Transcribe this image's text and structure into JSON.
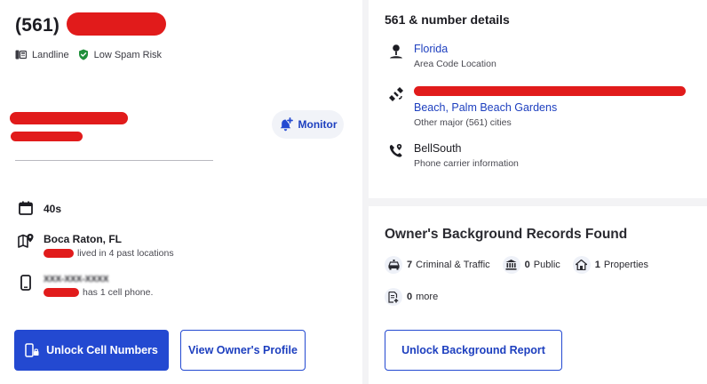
{
  "header": {
    "phone": "(561)",
    "line_type": "Landline",
    "spam_risk": "Low Spam Risk"
  },
  "owner": {
    "monitor_label": "Monitor"
  },
  "details": {
    "age": "40s",
    "city": "Boca Raton, FL",
    "locations_text": "lived in 4 past locations",
    "phone_mask": "XXX-XXX-XXXX",
    "cell_text": "has 1 cell phone."
  },
  "buttons": {
    "unlock_cell": "Unlock Cell Numbers",
    "view_profile": "View Owner's Profile",
    "unlock_background": "Unlock Background Report"
  },
  "number_details": {
    "title": "561 & number details",
    "area_code_location": "Florida",
    "area_code_label": "Area Code Location",
    "cities_line2": "Beach, Palm Beach Gardens",
    "cities_label": "Other major (561) cities",
    "carrier": "BellSouth",
    "carrier_label": "Phone carrier information"
  },
  "records": {
    "title": "Owner's Background Records Found",
    "criminal_count": "7",
    "criminal_label": "Criminal & Traffic",
    "public_count": "0",
    "public_label": "Public",
    "properties_count": "1",
    "properties_label": "Properties",
    "more_count": "0",
    "more_label": "more"
  },
  "colors": {
    "accent": "#2349d1",
    "redaction": "#e11b1b",
    "safe_green": "#1f8f3a"
  }
}
